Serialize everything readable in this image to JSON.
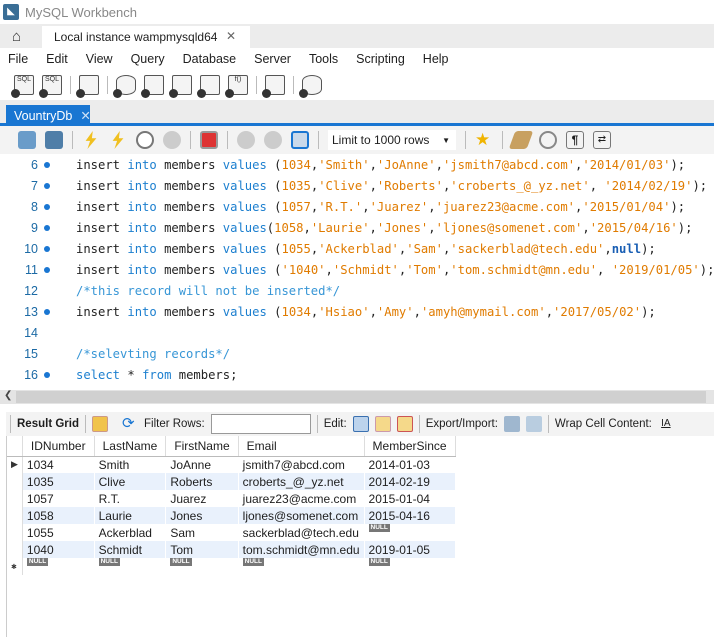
{
  "window": {
    "title": "MySQL Workbench"
  },
  "connection_tab": {
    "label": "Local instance wampmysqld64"
  },
  "menu": [
    "File",
    "Edit",
    "View",
    "Query",
    "Database",
    "Server",
    "Tools",
    "Scripting",
    "Help"
  ],
  "editor_tab": {
    "label": "VountryDb"
  },
  "editor_toolbar": {
    "limit_label": "Limit to 1000 rows"
  },
  "code_lines": [
    {
      "n": "6",
      "dot": true,
      "tokens": [
        [
          "id",
          "insert "
        ],
        [
          "kw",
          "into "
        ],
        [
          "id",
          "members "
        ],
        [
          "kw",
          "values "
        ],
        [
          "pun",
          "("
        ],
        [
          "str",
          "1034"
        ],
        [
          "pun",
          ","
        ],
        [
          "str",
          "'Smith'"
        ],
        [
          "pun",
          ","
        ],
        [
          "str",
          "'JoAnne'"
        ],
        [
          "pun",
          ","
        ],
        [
          "str",
          "'jsmith7@abcd.com'"
        ],
        [
          "pun",
          ","
        ],
        [
          "str",
          "'2014/01/03'"
        ],
        [
          "pun",
          ");"
        ]
      ]
    },
    {
      "n": "7",
      "dot": true,
      "tokens": [
        [
          "id",
          "insert "
        ],
        [
          "kw",
          "into "
        ],
        [
          "id",
          "members "
        ],
        [
          "kw",
          "values "
        ],
        [
          "pun",
          "("
        ],
        [
          "str",
          "1035"
        ],
        [
          "pun",
          ","
        ],
        [
          "str",
          "'Clive'"
        ],
        [
          "pun",
          ","
        ],
        [
          "str",
          "'Roberts'"
        ],
        [
          "pun",
          ","
        ],
        [
          "str",
          "'croberts_@_yz.net'"
        ],
        [
          "pun",
          ", "
        ],
        [
          "str",
          "'2014/02/19'"
        ],
        [
          "pun",
          ");"
        ]
      ]
    },
    {
      "n": "8",
      "dot": true,
      "tokens": [
        [
          "id",
          "insert "
        ],
        [
          "kw",
          "into "
        ],
        [
          "id",
          "members "
        ],
        [
          "kw",
          "values "
        ],
        [
          "pun",
          "("
        ],
        [
          "str",
          "1057"
        ],
        [
          "pun",
          ","
        ],
        [
          "str",
          "'R.T.'"
        ],
        [
          "pun",
          ","
        ],
        [
          "str",
          "'Juarez'"
        ],
        [
          "pun",
          ","
        ],
        [
          "str",
          "'juarez23@acme.com'"
        ],
        [
          "pun",
          ","
        ],
        [
          "str",
          "'2015/01/04'"
        ],
        [
          "pun",
          ");"
        ]
      ]
    },
    {
      "n": "9",
      "dot": true,
      "tokens": [
        [
          "id",
          "insert "
        ],
        [
          "kw",
          "into "
        ],
        [
          "id",
          "members "
        ],
        [
          "kw",
          "values"
        ],
        [
          "pun",
          "("
        ],
        [
          "str",
          "1058"
        ],
        [
          "pun",
          ","
        ],
        [
          "str",
          "'Laurie'"
        ],
        [
          "pun",
          ","
        ],
        [
          "str",
          "'Jones'"
        ],
        [
          "pun",
          ","
        ],
        [
          "str",
          "'ljones@somenet.com'"
        ],
        [
          "pun",
          ","
        ],
        [
          "str",
          "'2015/04/16'"
        ],
        [
          "pun",
          ");"
        ]
      ]
    },
    {
      "n": "10",
      "dot": true,
      "tokens": [
        [
          "id",
          "insert "
        ],
        [
          "kw",
          "into "
        ],
        [
          "id",
          "members "
        ],
        [
          "kw",
          "values "
        ],
        [
          "pun",
          "("
        ],
        [
          "str",
          "1055"
        ],
        [
          "pun",
          ","
        ],
        [
          "str",
          "'Ackerblad'"
        ],
        [
          "pun",
          ","
        ],
        [
          "str",
          "'Sam'"
        ],
        [
          "pun",
          ","
        ],
        [
          "str",
          "'sackerblad@tech.edu'"
        ],
        [
          "pun",
          ","
        ],
        [
          "kwb",
          "null"
        ],
        [
          "pun",
          ");"
        ]
      ]
    },
    {
      "n": "11",
      "dot": true,
      "tokens": [
        [
          "id",
          "insert "
        ],
        [
          "kw",
          "into "
        ],
        [
          "id",
          "members "
        ],
        [
          "kw",
          "values "
        ],
        [
          "pun",
          "("
        ],
        [
          "str",
          "'1040'"
        ],
        [
          "pun",
          ","
        ],
        [
          "str",
          "'Schmidt'"
        ],
        [
          "pun",
          ","
        ],
        [
          "str",
          "'Tom'"
        ],
        [
          "pun",
          ","
        ],
        [
          "str",
          "'tom.schmidt@mn.edu'"
        ],
        [
          "pun",
          ", "
        ],
        [
          "str",
          "'2019/01/05'"
        ],
        [
          "pun",
          ");"
        ]
      ]
    },
    {
      "n": "12",
      "dot": false,
      "tokens": [
        [
          "cm",
          "/*this record will not be inserted*/"
        ]
      ]
    },
    {
      "n": "13",
      "dot": true,
      "tokens": [
        [
          "id",
          "insert "
        ],
        [
          "kw",
          "into "
        ],
        [
          "id",
          "members "
        ],
        [
          "kw",
          "values "
        ],
        [
          "pun",
          "("
        ],
        [
          "str",
          "1034"
        ],
        [
          "pun",
          ","
        ],
        [
          "str",
          "'Hsiao'"
        ],
        [
          "pun",
          ","
        ],
        [
          "str",
          "'Amy'"
        ],
        [
          "pun",
          ","
        ],
        [
          "str",
          "'amyh@mymail.com'"
        ],
        [
          "pun",
          ","
        ],
        [
          "str",
          "'2017/05/02'"
        ],
        [
          "pun",
          ");"
        ]
      ]
    },
    {
      "n": "14",
      "dot": false,
      "tokens": []
    },
    {
      "n": "15",
      "dot": false,
      "tokens": [
        [
          "cm",
          "/*selevting records*/"
        ]
      ]
    },
    {
      "n": "16",
      "dot": true,
      "tokens": [
        [
          "kw",
          "select "
        ],
        [
          "id",
          "* "
        ],
        [
          "kw",
          "from "
        ],
        [
          "id",
          "members;"
        ]
      ]
    }
  ],
  "result_toolbar": {
    "result_grid": "Result Grid",
    "filter_rows": "Filter Rows:",
    "filter_value": "",
    "edit": "Edit:",
    "export_import": "Export/Import:",
    "wrap": "Wrap Cell Content:"
  },
  "grid": {
    "columns": [
      "IDNumber",
      "LastName",
      "FirstName",
      "Email",
      "MemberSince"
    ],
    "rows": [
      [
        "1034",
        "Smith",
        "JoAnne",
        "jsmith7@abcd.com",
        "2014-01-03"
      ],
      [
        "1035",
        "Clive",
        "Roberts",
        "croberts_@_yz.net",
        "2014-02-19"
      ],
      [
        "1057",
        "R.T.",
        "Juarez",
        "juarez23@acme.com",
        "2015-01-04"
      ],
      [
        "1058",
        "Laurie",
        "Jones",
        "ljones@somenet.com",
        "2015-04-16"
      ],
      [
        "1055",
        "Ackerblad",
        "Sam",
        "sackerblad@tech.edu",
        "NULL"
      ],
      [
        "1040",
        "Schmidt",
        "Tom",
        "tom.schmidt@mn.edu",
        "2019-01-05"
      ]
    ],
    "null_label": "NULL"
  }
}
